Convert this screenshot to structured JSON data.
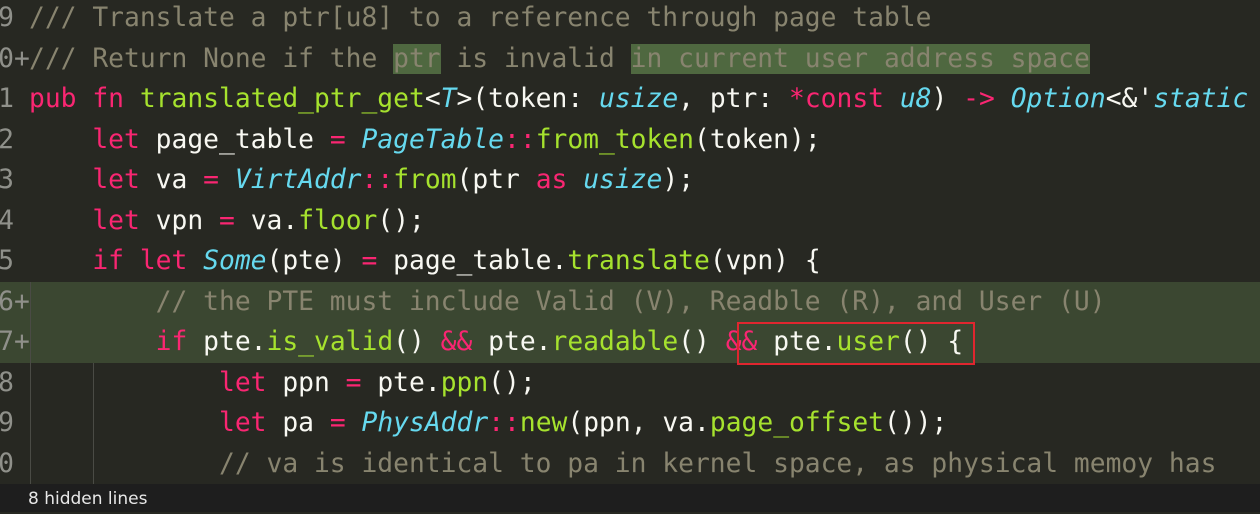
{
  "editor": {
    "lines": [
      {
        "num": "9",
        "mark": " ",
        "added": false,
        "tokens": [
          {
            "t": "/// Translate a ptr[u8] to a reference through page table",
            "c": "t-comment"
          }
        ]
      },
      {
        "num": "0",
        "mark": "+",
        "added": false,
        "tokens": [
          {
            "t": "/// Return None if the ",
            "c": "t-comment"
          },
          {
            "t": "ptr",
            "c": "t-comment hl-word"
          },
          {
            "t": " is invalid ",
            "c": "t-comment"
          },
          {
            "t": "in current user address space",
            "c": "t-comment hl-word"
          }
        ]
      },
      {
        "num": "1",
        "mark": " ",
        "added": false,
        "tokens": [
          {
            "t": "pub fn ",
            "c": "t-kw"
          },
          {
            "t": "translated_ptr_get",
            "c": "t-fn"
          },
          {
            "t": "<",
            "c": "t-punc"
          },
          {
            "t": "T",
            "c": "t-type"
          },
          {
            "t": ">(token: ",
            "c": "t-punc"
          },
          {
            "t": "usize",
            "c": "t-type"
          },
          {
            "t": ", ptr: ",
            "c": "t-punc"
          },
          {
            "t": "*const ",
            "c": "t-kw"
          },
          {
            "t": "u8",
            "c": "t-type"
          },
          {
            "t": ") ",
            "c": "t-punc"
          },
          {
            "t": "->",
            "c": "t-op"
          },
          {
            "t": " ",
            "c": "t-punc"
          },
          {
            "t": "Option",
            "c": "t-type"
          },
          {
            "t": "<&'",
            "c": "t-punc"
          },
          {
            "t": "static",
            "c": "t-type"
          }
        ]
      },
      {
        "num": "2",
        "mark": " ",
        "added": false,
        "tokens": [
          {
            "t": "    let ",
            "c": "t-kw"
          },
          {
            "t": "page_table ",
            "c": "t-punc"
          },
          {
            "t": "=",
            "c": "t-op"
          },
          {
            "t": " ",
            "c": "t-punc"
          },
          {
            "t": "PageTable",
            "c": "t-type"
          },
          {
            "t": "::",
            "c": "t-op"
          },
          {
            "t": "from_token",
            "c": "t-fn"
          },
          {
            "t": "(token);",
            "c": "t-punc"
          }
        ]
      },
      {
        "num": "3",
        "mark": " ",
        "added": false,
        "tokens": [
          {
            "t": "    let ",
            "c": "t-kw"
          },
          {
            "t": "va ",
            "c": "t-punc"
          },
          {
            "t": "=",
            "c": "t-op"
          },
          {
            "t": " ",
            "c": "t-punc"
          },
          {
            "t": "VirtAddr",
            "c": "t-type"
          },
          {
            "t": "::",
            "c": "t-op"
          },
          {
            "t": "from",
            "c": "t-fn"
          },
          {
            "t": "(ptr ",
            "c": "t-punc"
          },
          {
            "t": "as ",
            "c": "t-kw"
          },
          {
            "t": "usize",
            "c": "t-type"
          },
          {
            "t": ");",
            "c": "t-punc"
          }
        ]
      },
      {
        "num": "4",
        "mark": " ",
        "added": false,
        "tokens": [
          {
            "t": "    let ",
            "c": "t-kw"
          },
          {
            "t": "vpn ",
            "c": "t-punc"
          },
          {
            "t": "=",
            "c": "t-op"
          },
          {
            "t": " va.",
            "c": "t-punc"
          },
          {
            "t": "floor",
            "c": "t-fn"
          },
          {
            "t": "();",
            "c": "t-punc"
          }
        ]
      },
      {
        "num": "5",
        "mark": " ",
        "added": false,
        "tokens": [
          {
            "t": "    if let ",
            "c": "t-kw"
          },
          {
            "t": "Some",
            "c": "t-type"
          },
          {
            "t": "(pte) ",
            "c": "t-punc"
          },
          {
            "t": "=",
            "c": "t-op"
          },
          {
            "t": " page_table.",
            "c": "t-punc"
          },
          {
            "t": "translate",
            "c": "t-fn"
          },
          {
            "t": "(vpn) {",
            "c": "t-punc"
          }
        ]
      },
      {
        "num": "6",
        "mark": "+",
        "added": true,
        "tokens": [
          {
            "t": "        // the PTE must include Valid (V), Readble (R), and User (U)",
            "c": "t-comment"
          }
        ]
      },
      {
        "num": "7",
        "mark": "+",
        "added": true,
        "tokens": [
          {
            "t": "        if ",
            "c": "t-kw"
          },
          {
            "t": "pte.",
            "c": "t-punc"
          },
          {
            "t": "is_valid",
            "c": "t-fn"
          },
          {
            "t": "() ",
            "c": "t-punc"
          },
          {
            "t": "&&",
            "c": "t-op"
          },
          {
            "t": " pte.",
            "c": "t-punc"
          },
          {
            "t": "readable",
            "c": "t-fn"
          },
          {
            "t": "() ",
            "c": "t-punc"
          },
          {
            "t": "&&",
            "c": "t-op"
          },
          {
            "t": " pte.",
            "c": "t-punc"
          },
          {
            "t": "user",
            "c": "t-fn"
          },
          {
            "t": "() {",
            "c": "t-punc"
          }
        ]
      },
      {
        "num": "8",
        "mark": " ",
        "added": false,
        "tokens": [
          {
            "t": "            let ",
            "c": "t-kw"
          },
          {
            "t": "ppn ",
            "c": "t-punc"
          },
          {
            "t": "=",
            "c": "t-op"
          },
          {
            "t": " pte.",
            "c": "t-punc"
          },
          {
            "t": "ppn",
            "c": "t-fn"
          },
          {
            "t": "();",
            "c": "t-punc"
          }
        ]
      },
      {
        "num": "9",
        "mark": " ",
        "added": false,
        "tokens": [
          {
            "t": "            let ",
            "c": "t-kw"
          },
          {
            "t": "pa ",
            "c": "t-punc"
          },
          {
            "t": "=",
            "c": "t-op"
          },
          {
            "t": " ",
            "c": "t-punc"
          },
          {
            "t": "PhysAddr",
            "c": "t-type"
          },
          {
            "t": "::",
            "c": "t-op"
          },
          {
            "t": "new",
            "c": "t-fn"
          },
          {
            "t": "(ppn, va.",
            "c": "t-punc"
          },
          {
            "t": "page_offset",
            "c": "t-fn"
          },
          {
            "t": "());",
            "c": "t-punc"
          }
        ]
      },
      {
        "num": "0",
        "mark": " ",
        "added": false,
        "tokens": [
          {
            "t": "            // va is identical to pa in kernel space, as physical memoy has",
            "c": "t-comment"
          }
        ]
      }
    ]
  },
  "footer": {
    "hidden_lines": "8 hidden lines"
  },
  "colors": {
    "background": "#272822",
    "added_line": "#3b4731",
    "highlight_box": "#e0262f"
  }
}
